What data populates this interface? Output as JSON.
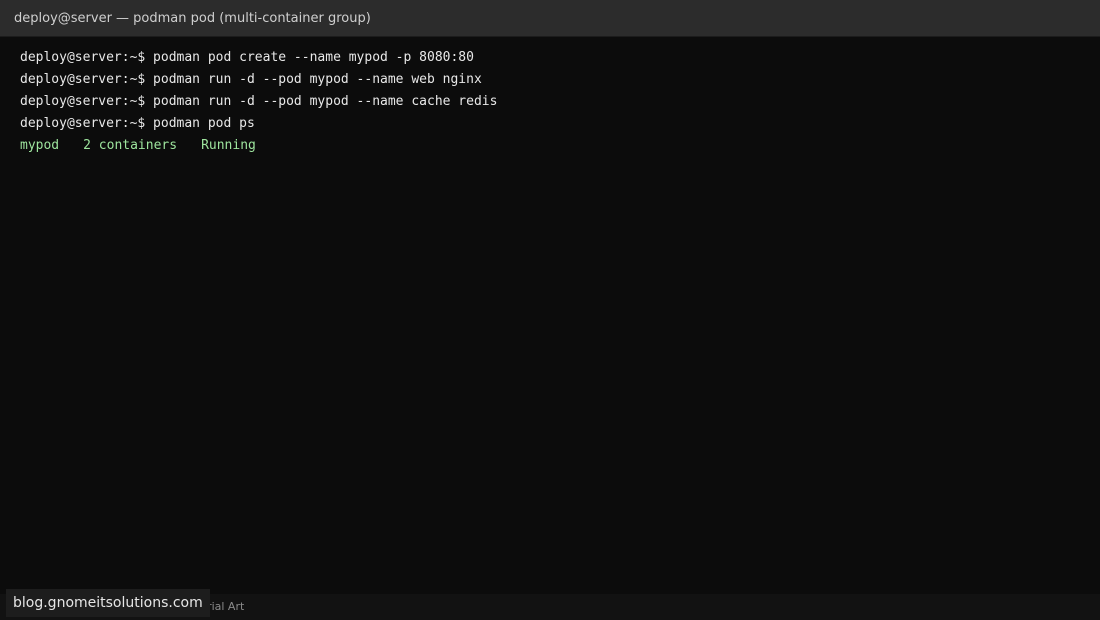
{
  "window": {
    "title": "deploy@server — podman pod (multi-container group)"
  },
  "terminal": {
    "lines": [
      {
        "type": "command",
        "text": "deploy@server:~$ podman pod create --name mypod -p 8080:80"
      },
      {
        "type": "command",
        "text": "deploy@server:~$ podman run -d --pod mypod --name web nginx"
      },
      {
        "type": "command",
        "text": "deploy@server:~$ podman run -d --pod mypod --name cache redis"
      },
      {
        "type": "command",
        "text": "deploy@server:~$ podman pod ps"
      }
    ],
    "output": {
      "pod_name": "mypod",
      "containers": "2 containers",
      "status": "Running"
    }
  },
  "statusbar": {
    "text": "Tutorial Art"
  },
  "watermark": {
    "text": "blog.gnomeitsolutions.com"
  },
  "colors": {
    "background": "#0c0c0c",
    "titlebar": "#2c2c2c",
    "text": "#e8e8e8",
    "output": "#9ee59e"
  }
}
